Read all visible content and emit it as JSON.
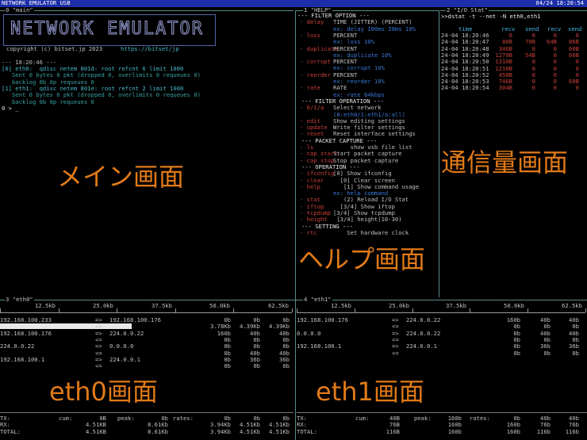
{
  "titlebar": {
    "title": "NETWORK EMULATOR USB",
    "clock": "04/24 18:20:54"
  },
  "main": {
    "pane_title": "0 \"main\"",
    "logo_text": "NETWORK EMULATOR",
    "copyright": "copyright (c) bitset.jp 2023",
    "url": "https://bitset/jp",
    "time_line": "--- 18:20:46 ---",
    "lines": [
      "[0] eth0:  qdisc netem 801d: root refcnt 6 limit 1000",
      "   Sent 0 bytes 0 pkt (dropped 0, overlimits 0 requeues 0)",
      "   backlog 0b 0p requeues 0",
      "[1] eth1:  qdisc netem 801e: root refcnt 2 limit 1000",
      "   Sent 0 bytes 0 pkt (dropped 0, overlimits 0 requeues 0)",
      "   backlog 0b 0p requeues 0"
    ],
    "prompt": "0 > _",
    "overlay_label": "メイン画面"
  },
  "help": {
    "pane_title": "1 \"HELP\"",
    "overlay_label": "ヘルプ画面",
    "lines": [
      {
        "k": "--- FILTER OPTION ---",
        "v": "",
        "s": "sec"
      },
      {
        "k": "- delay",
        "v": "TIME (JITTER) (PERCENT)",
        "s": "cmd"
      },
      {
        "k": "",
        "v": "ex: delay 100ms 20ms 10%",
        "s": "ex"
      },
      {
        "k": "- loss",
        "v": "PERCENT",
        "s": "cmd"
      },
      {
        "k": "",
        "v": "ex: loss 10%",
        "s": "ex"
      },
      {
        "k": "- duplicate",
        "v": "PERCENT",
        "s": "cmd"
      },
      {
        "k": "",
        "v": "ex: duplicate 10%",
        "s": "ex"
      },
      {
        "k": "- corrupt",
        "v": "PERCENT",
        "s": "cmd"
      },
      {
        "k": "",
        "v": "ex: corrupt 10%",
        "s": "ex"
      },
      {
        "k": "- reorder",
        "v": "PERCENT",
        "s": "cmd"
      },
      {
        "k": "",
        "v": "ex: reorder 10%",
        "s": "ex"
      },
      {
        "k": "- rate",
        "v": "RATE",
        "s": "cmd"
      },
      {
        "k": "",
        "v": "ex: rate 64kbps",
        "s": "ex"
      },
      {
        "k": "--- FILTER OPERATION ---",
        "v": "",
        "s": "sec"
      },
      {
        "k": "- 0/1/a",
        "v": "Select network",
        "s": "cmd"
      },
      {
        "k": "",
        "v": "(0:eth0/1:eth1/a:all)",
        "s": "ex"
      },
      {
        "k": "- edit",
        "v": "Show editing settings",
        "s": "cmd"
      },
      {
        "k": "- update",
        "v": "Write filter settings",
        "s": "cmd"
      },
      {
        "k": "- reset",
        "v": "Reset interface settings",
        "s": "cmd"
      },
      {
        "k": "--- PACKET CAPTURE ---",
        "v": "",
        "s": "sec"
      },
      {
        "k": "- ls",
        "v": "     show usb file list",
        "s": "cmd"
      },
      {
        "k": "- cap start",
        "v": "Start packet capture",
        "s": "cmd"
      },
      {
        "k": "- cap stop",
        "v": "Stop packet capture",
        "s": "cmd"
      },
      {
        "k": "--- OPERATION ---",
        "v": "",
        "s": "sec"
      },
      {
        "k": "- ifconfig",
        "v": "[0] Show ifconfig",
        "s": "cmd"
      },
      {
        "k": "- clear",
        "v": "  [0] Clear screen",
        "s": "cmd"
      },
      {
        "k": "- help",
        "v": "   [1] Show command usage",
        "s": "cmd"
      },
      {
        "k": "",
        "v": "ex: help command",
        "s": "ex"
      },
      {
        "k": "- stat",
        "v": "   (2) Reload I/O Stat",
        "s": "cmd"
      },
      {
        "k": "- iftop",
        "v": "  [3/4] Show iftop",
        "s": "cmd"
      },
      {
        "k": "- tcpdump",
        "v": "[3/4] Show tcpdump",
        "s": "cmd"
      },
      {
        "k": "- height",
        "v": " [3/4] height(10-30)",
        "s": "cmd"
      },
      {
        "k": "--- SETTING ---",
        "v": "",
        "s": "sec"
      },
      {
        "k": "- rtc",
        "v": "    Set hardware clock",
        "s": "cmd"
      }
    ]
  },
  "stat": {
    "pane_title": "2 \"I/O Stat\"",
    "command": ">>dstat -t --net -N eth0,eth1",
    "overlay_label": "通信量画面",
    "headers": [
      "time",
      "recv",
      "send",
      "recv",
      "send"
    ],
    "rows": [
      [
        "24-04 18:20:46",
        "0",
        "0",
        "0",
        "0"
      ],
      [
        "24-04 18:20:47",
        "86B",
        "70B",
        "64B",
        "86B"
      ],
      [
        "24-04 18:20:48",
        "346B",
        "0",
        "0",
        "60B"
      ],
      [
        "24-04 18:20:49",
        "1279B",
        "54B",
        "0",
        "60B"
      ],
      [
        "24-04 18:20:50",
        "1310B",
        "0",
        "0",
        "0"
      ],
      [
        "24-04 18:20:51",
        "1210B",
        "0",
        "0",
        "0"
      ],
      [
        "24-04 18:20:52",
        "458B",
        "0",
        "0",
        "0"
      ],
      [
        "24-04 18:20:53",
        "746B",
        "0",
        "0",
        "60B"
      ],
      [
        "24-04 18:20:54",
        "304B",
        "0",
        "0",
        "0"
      ]
    ]
  },
  "eth0": {
    "pane_title": "3 \"eth0\"",
    "overlay_label": "eth0画面",
    "scale": [
      "12.5kb",
      "25.0kb",
      "37.5kb",
      "50.0kb",
      "62.5kb"
    ],
    "flows": [
      {
        "a": "192.168.100.233",
        "dir1": "=>",
        "b": "192.168.100.176",
        "c1": "0b",
        "c2": "0b",
        "c3": "0b",
        "dir2": "<=",
        "d1": "3.78Kb",
        "d2": "4.39Kb",
        "d3": "4.39Kb",
        "bar": 0.06
      },
      {
        "a": "192.168.100.176",
        "dir1": "=>",
        "b": "224.0.0.22",
        "c1": "160b",
        "c2": "40b",
        "c3": "40b",
        "dir2": "<=",
        "d1": "0b",
        "d2": "0b",
        "d3": "0b",
        "bar": 0
      },
      {
        "a": "224.0.0.22",
        "dir1": "=>",
        "b": "0.0.0.0",
        "c1": "0b",
        "c2": "0b",
        "c3": "0b",
        "dir2": "<=",
        "d1": "0b",
        "d2": "40b",
        "d3": "40b",
        "bar": 0
      },
      {
        "a": "192.168.100.1",
        "dir1": "=>",
        "b": "224.0.0.1",
        "c1": "0b",
        "c2": "36b",
        "c3": "36b",
        "dir2": "<=",
        "d1": "0b",
        "d2": "0b",
        "d3": "0b",
        "bar": 0
      }
    ],
    "totals": [
      {
        "label": "TX:",
        "cum": "0B",
        "peak": "0b",
        "r1": "0b",
        "r2": "0b",
        "r3": "0b",
        "show_labels": true
      },
      {
        "label": "RX:",
        "cum": "4.51KB",
        "peak": "8.61Kb",
        "r1": "3.94Kb",
        "r2": "4.51Kb",
        "r3": "4.51Kb",
        "show_labels": false
      },
      {
        "label": "TOTAL:",
        "cum": "4.51KB",
        "peak": "8.61Kb",
        "r1": "3.94Kb",
        "r2": "4.51Kb",
        "r3": "4.51Kb",
        "show_labels": false
      }
    ],
    "label_cum": "cum:",
    "label_peak": "peak:",
    "label_rates": "rates:"
  },
  "eth1": {
    "pane_title": "4 \"eth1\"",
    "overlay_label": "eth1画面",
    "scale": [
      "12.5kb",
      "25.0kb",
      "37.5kb",
      "50.0kb",
      "62.5kb"
    ],
    "flows": [
      {
        "a": "192.168.100.176",
        "dir1": "=>",
        "b": "224.0.0.22",
        "c1": "160b",
        "c2": "40b",
        "c3": "40b",
        "dir2": "<=",
        "d1": "0b",
        "d2": "0b",
        "d3": "0b"
      },
      {
        "a": "0.0.0.0",
        "dir1": "=>",
        "b": "224.0.0.22",
        "c1": "0b",
        "c2": "40b",
        "c3": "40b",
        "dir2": "<=",
        "d1": "0b",
        "d2": "0b",
        "d3": "0b"
      },
      {
        "a": "192.168.100.1",
        "dir1": "=>",
        "b": "224.0.0.1",
        "c1": "0b",
        "c2": "36b",
        "c3": "36b",
        "dir2": "<=",
        "d1": "0b",
        "d2": "0b",
        "d3": "0b"
      }
    ],
    "totals": [
      {
        "label": "TX:",
        "cum": "40B",
        "peak": "160b",
        "r1": "0b",
        "r2": "40b",
        "r3": "40b"
      },
      {
        "label": "RX:",
        "cum": "76B",
        "peak": "160b",
        "r1": "160b",
        "r2": "76b",
        "r3": "76b"
      },
      {
        "label": "TOTAL:",
        "cum": "116B",
        "peak": "160b",
        "r1": "160b",
        "r2": "116b",
        "r3": "116b"
      }
    ],
    "label_cum": "cum:",
    "label_peak": "peak:",
    "label_rates": "rates:"
  }
}
